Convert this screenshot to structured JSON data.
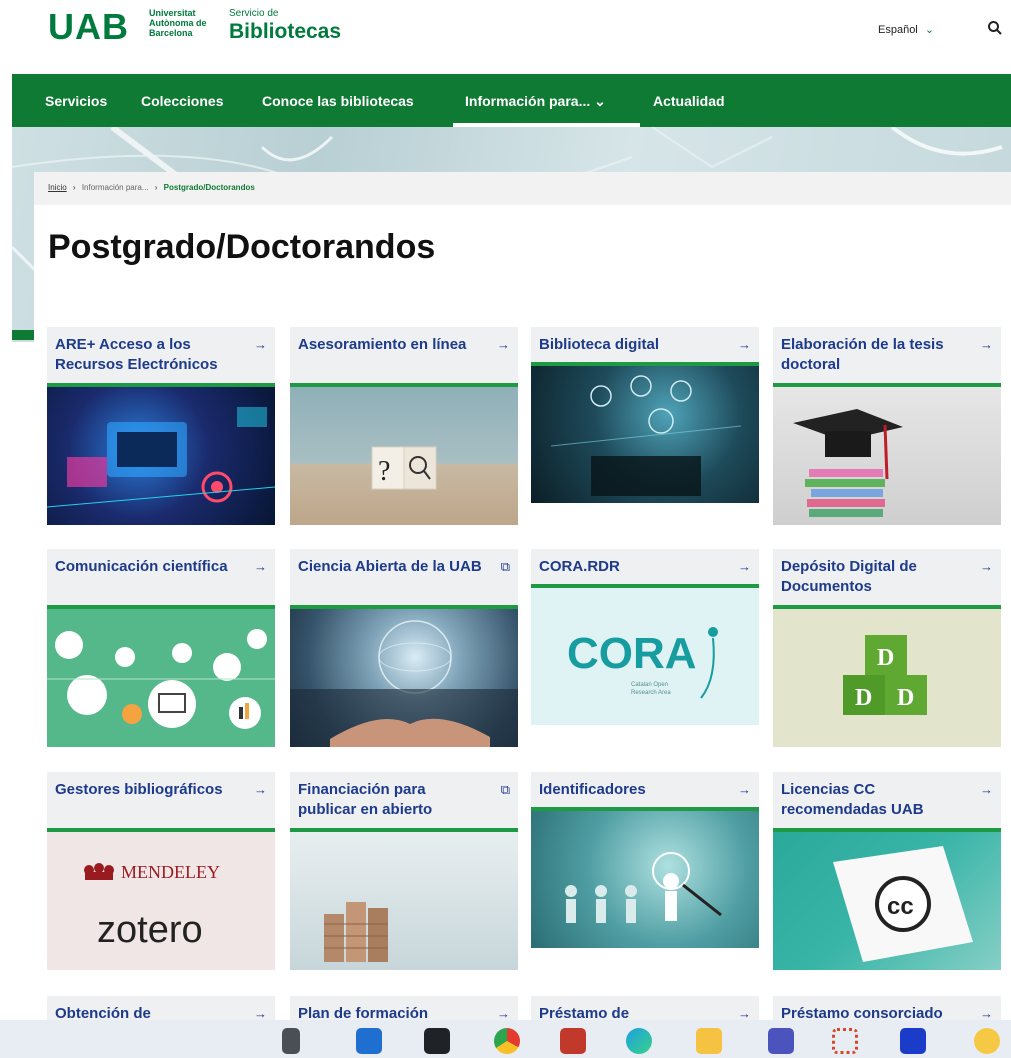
{
  "header": {
    "logo_main": "UAB",
    "logo_univ": "Universitat Autònoma de Barcelona",
    "logo_serv_small": "Servicio de",
    "logo_serv_big": "Bibliotecas",
    "language": "Español",
    "language_chevron": "⌄"
  },
  "nav": {
    "items": [
      "Servicios",
      "Colecciones",
      "Conoce las bibliotecas",
      "Información para... ⌄",
      "Actualidad"
    ]
  },
  "breadcrumb": {
    "home": "Inicio",
    "sep": "›",
    "middle": "Información para...",
    "current": "Postgrado/Doctorandos"
  },
  "page": {
    "title": "Postgrado/Doctorandos"
  },
  "tiles": [
    {
      "title": "ARE+ Acceso a los Recursos Electrónicos",
      "icon": "→"
    },
    {
      "title": "Asesoramiento en línea",
      "icon": "→"
    },
    {
      "title": "Biblioteca digital",
      "icon": "→"
    },
    {
      "title": "Elaboración de la tesis doctoral",
      "icon": "→"
    },
    {
      "title": "Comunicación científica",
      "icon": "→"
    },
    {
      "title": "Ciencia Abierta de la UAB",
      "icon": "⧉"
    },
    {
      "title": "CORA.RDR",
      "icon": "→"
    },
    {
      "title": "Depósito Digital de Documentos",
      "icon": "→"
    },
    {
      "title": "Gestores bibliográficos",
      "icon": "→"
    },
    {
      "title": "Financiación para publicar en abierto",
      "icon": "⧉"
    },
    {
      "title": "Identificadores",
      "icon": "→"
    },
    {
      "title": "Licencias CC recomendadas UAB",
      "icon": "→"
    },
    {
      "title": "Obtención de",
      "icon": "→"
    },
    {
      "title": "Plan de formación",
      "icon": "→"
    },
    {
      "title": "Préstamo de",
      "icon": "→"
    },
    {
      "title": "Préstamo consorciado",
      "icon": "→"
    }
  ],
  "images": {
    "cora_text": "CORA",
    "cora_sub1": "Catalan Open",
    "cora_sub2": "Research Area",
    "mendeley": "MENDELEY",
    "zotero": "zotero",
    "cc": "cc",
    "question": "?",
    "ddd": "D"
  },
  "colors": {
    "brand_green": "#0f7a33",
    "tile_title_blue": "#1e3a8a",
    "tile_accent": "#1f9a44"
  }
}
